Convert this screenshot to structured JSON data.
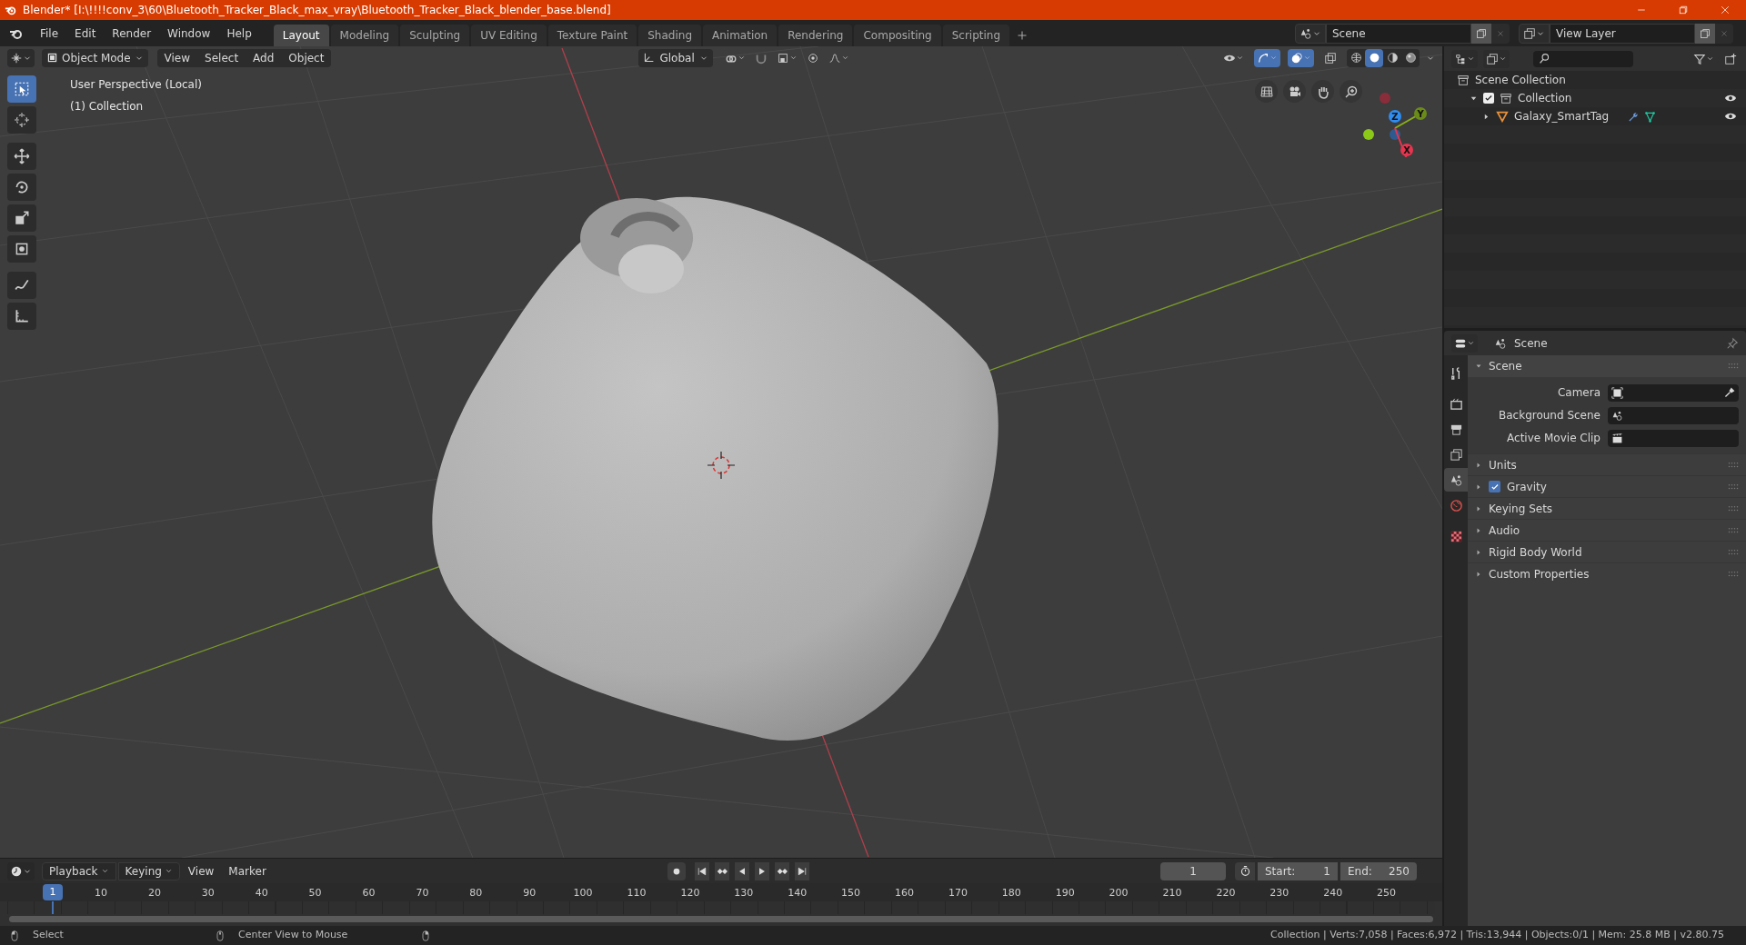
{
  "window": {
    "title": "Blender* [I:\\!!!!conv_3\\60\\Bluetooth_Tracker_Black_max_vray\\Bluetooth_Tracker_Black_blender_base.blend]"
  },
  "menu": [
    "File",
    "Edit",
    "Render",
    "Window",
    "Help"
  ],
  "workspaces": [
    {
      "label": "Layout",
      "selected": true
    },
    {
      "label": "Modeling",
      "selected": false
    },
    {
      "label": "Sculpting",
      "selected": false
    },
    {
      "label": "UV Editing",
      "selected": false
    },
    {
      "label": "Texture Paint",
      "selected": false
    },
    {
      "label": "Shading",
      "selected": false
    },
    {
      "label": "Animation",
      "selected": false
    },
    {
      "label": "Rendering",
      "selected": false
    },
    {
      "label": "Compositing",
      "selected": false
    },
    {
      "label": "Scripting",
      "selected": false
    }
  ],
  "scene_field": "Scene",
  "view_layer_field": "View Layer",
  "viewport": {
    "mode": "Object Mode",
    "menus": [
      "View",
      "Select",
      "Add",
      "Object"
    ],
    "orientation": "Global",
    "shading": [
      {
        "kind": "wireframe",
        "selected": false
      },
      {
        "kind": "solid",
        "selected": true
      },
      {
        "kind": "material",
        "selected": false
      },
      {
        "kind": "rendered",
        "selected": false
      }
    ],
    "overlay_text": [
      "User Perspective (Local)",
      "(1) Collection"
    ],
    "tools": [
      {
        "kind": "select",
        "selected": true
      },
      {
        "kind": "cursor",
        "selected": false
      },
      {
        "kind": "move",
        "selected": false
      },
      {
        "kind": "rotate",
        "selected": false
      },
      {
        "kind": "scale",
        "selected": false
      },
      {
        "kind": "transform",
        "selected": false
      },
      {
        "kind": "annotate",
        "selected": false
      },
      {
        "kind": "measure",
        "selected": false
      }
    ],
    "gizmo_axes": [
      "Z",
      "Y",
      "X"
    ]
  },
  "outliner": {
    "items": [
      {
        "label": "Scene Collection",
        "kind": "scene",
        "children": [
          {
            "label": "Collection",
            "kind": "collection",
            "expanded": true,
            "checked": true,
            "children": [
              {
                "label": "Galaxy_SmartTag",
                "kind": "mesh",
                "expanded": false
              }
            ]
          }
        ]
      }
    ]
  },
  "properties": {
    "context": "Scene",
    "tabs": [
      {
        "kind": "tool",
        "selected": false
      },
      {
        "kind": "render",
        "selected": false
      },
      {
        "kind": "output",
        "selected": false
      },
      {
        "kind": "view_layer",
        "selected": false
      },
      {
        "kind": "scene",
        "selected": true
      },
      {
        "kind": "world",
        "selected": false
      },
      {
        "kind": "texture",
        "selected": false
      }
    ],
    "panel": {
      "title": "Scene",
      "expanded": true,
      "fields": [
        {
          "label": "Camera",
          "kind": "camera"
        },
        {
          "label": "Background Scene",
          "kind": "scene"
        },
        {
          "label": "Active Movie Clip",
          "kind": "clip"
        }
      ]
    },
    "sections": [
      {
        "label": "Units",
        "kind": "plain",
        "expanded": false
      },
      {
        "label": "Gravity",
        "kind": "checkbox",
        "checked": true,
        "expanded": false
      },
      {
        "label": "Keying Sets",
        "kind": "plain",
        "expanded": false
      },
      {
        "label": "Audio",
        "kind": "plain",
        "expanded": false
      },
      {
        "label": "Rigid Body World",
        "kind": "plain",
        "expanded": false
      },
      {
        "label": "Custom Properties",
        "kind": "plain",
        "expanded": false
      }
    ]
  },
  "timeline": {
    "menus": [
      {
        "label": "Playback",
        "kind": "dropdown"
      },
      {
        "label": "Keying",
        "kind": "dropdown"
      },
      {
        "label": "View",
        "kind": "plain"
      },
      {
        "label": "Marker",
        "kind": "plain"
      }
    ],
    "current_frame": "1",
    "start_label": "Start:",
    "start": "1",
    "end_label": "End:",
    "end": "250",
    "playhead": "1",
    "ticks": [
      "10",
      "20",
      "30",
      "40",
      "50",
      "60",
      "70",
      "80",
      "90",
      "100",
      "110",
      "120",
      "130",
      "140",
      "150",
      "160",
      "170",
      "180",
      "190",
      "200",
      "210",
      "220",
      "230",
      "240",
      "250"
    ]
  },
  "status_bar": {
    "hints": [
      "Select",
      "Center View to Mouse"
    ],
    "stats": "Collection | Verts:7,058 | Faces:6,972 | Tris:13,944 | Objects:0/1 | Mem: 25.8 MB | v2.80.75"
  }
}
